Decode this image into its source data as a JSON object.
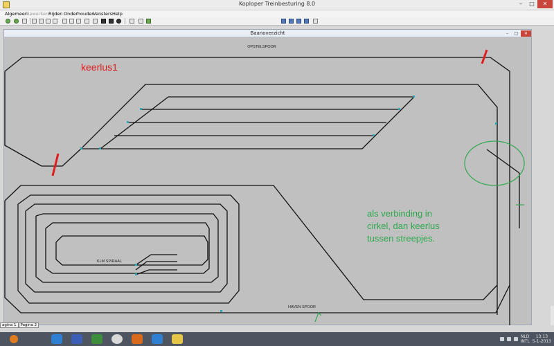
{
  "app": {
    "title": "Koploper Treinbesturing 8.0"
  },
  "window_controls": {
    "minimize": "–",
    "maximize": "□",
    "close": "✕"
  },
  "menu": [
    "Algemeen",
    "Bewerken",
    "Rijden",
    "Onderhouden",
    "Vensters",
    "Help"
  ],
  "child_window": {
    "title": "Baanoverzicht"
  },
  "track_labels": {
    "opstelspoor": "OPSTELSPOOR",
    "klm_spiraal": "KLM SPIRAAL",
    "haven_spoor": "HAVEN SPOOR"
  },
  "annotations": {
    "keerlus": "keerlus1",
    "note_line1": "als verbinding in",
    "note_line2": "cirkel, dan keerlus",
    "note_line3": "tussen streepjes."
  },
  "page_tabs": [
    "agina 1",
    "Pagina 2"
  ],
  "tray": {
    "lang_top": "NLD",
    "lang_bottom": "INTL",
    "time": "13:13",
    "date": "5-1-2013"
  },
  "colors": {
    "annotation_red": "#e01e1e",
    "annotation_green": "#2fa84f",
    "connector_teal": "#2aa9b5",
    "track": "#101010"
  }
}
